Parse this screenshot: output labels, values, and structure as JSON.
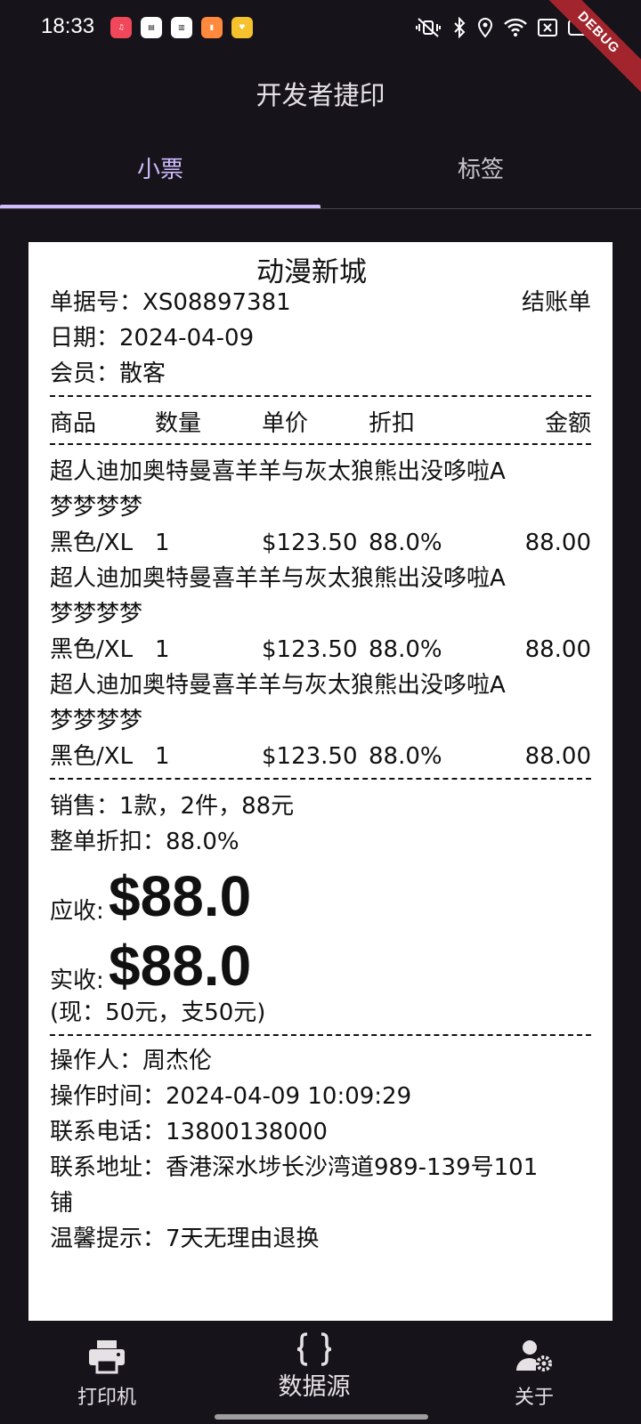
{
  "status_bar": {
    "time": "18:33",
    "notification_icons": [
      {
        "icon": "music-app-icon",
        "color": "#f0475a",
        "text": ""
      },
      {
        "icon": "news-app-icon",
        "color": "#ffffff",
        "text": ""
      },
      {
        "icon": "news-app-icon-2",
        "color": "#ffffff",
        "text": ""
      },
      {
        "icon": "book-app-icon",
        "color": "#ff8a3d",
        "text": ""
      },
      {
        "icon": "coupon-app-icon",
        "color": "#f5c12c",
        "text": ""
      }
    ],
    "debug_badge": "DEBUG"
  },
  "app_bar": {
    "title": "开发者捷印"
  },
  "tabs": [
    {
      "label": "小票",
      "selected": true
    },
    {
      "label": "标签",
      "selected": false
    }
  ],
  "colors": {
    "accent": "#d0bcff",
    "background": "#16141a",
    "paper": "#ffffff",
    "debug": "#a2252d"
  },
  "receipt": {
    "shop_name": "动漫新城",
    "order_no_label": "单据号：",
    "order_no": "XS08897381",
    "doc_type": "结账单",
    "date_label": "日期：",
    "date": "2024-04-09",
    "member_label": "会员：",
    "member": "散客",
    "columns": [
      "商品",
      "数量",
      "单价",
      "折扣",
      "金额"
    ],
    "items": [
      {
        "name_line1": "超人迪加奥特曼喜羊羊与灰太狼熊出没哆啦A",
        "name_line2": "梦梦梦梦",
        "spec": "黑色/XL",
        "qty": "1",
        "price": "$123.50",
        "discount": "88.0%",
        "amount": "88.00"
      },
      {
        "name_line1": "超人迪加奥特曼喜羊羊与灰太狼熊出没哆啦A",
        "name_line2": "梦梦梦梦",
        "spec": "黑色/XL",
        "qty": "1",
        "price": "$123.50",
        "discount": "88.0%",
        "amount": "88.00"
      },
      {
        "name_line1": "超人迪加奥特曼喜羊羊与灰太狼熊出没哆啦A",
        "name_line2": "梦梦梦梦",
        "spec": "黑色/XL",
        "qty": "1",
        "price": "$123.50",
        "discount": "88.0%",
        "amount": "88.00"
      }
    ],
    "sales_summary": "销售：1款，2件，88元",
    "overall_discount": "整单折扣：88.0%",
    "receivable_label": "应收:",
    "receivable_amount": "$88.0",
    "received_label": "实收:",
    "received_amount": "$88.0",
    "payment_note": "(现：50元，支50元)",
    "operator": "操作人：周杰伦",
    "operate_time": "操作时间：2024-04-09 10:09:29",
    "phone": "联系电话：13800138000",
    "address_line1": "联系地址：香港深水埗长沙湾道989-139号101",
    "address_line2": "铺",
    "tip": "温馨提示：7天无理由退换"
  },
  "bottom_nav": [
    {
      "label": "打印机",
      "icon": "printer-icon"
    },
    {
      "label": "数据源",
      "icon": "braces-icon"
    },
    {
      "label": "关于",
      "icon": "user-settings-icon"
    }
  ]
}
